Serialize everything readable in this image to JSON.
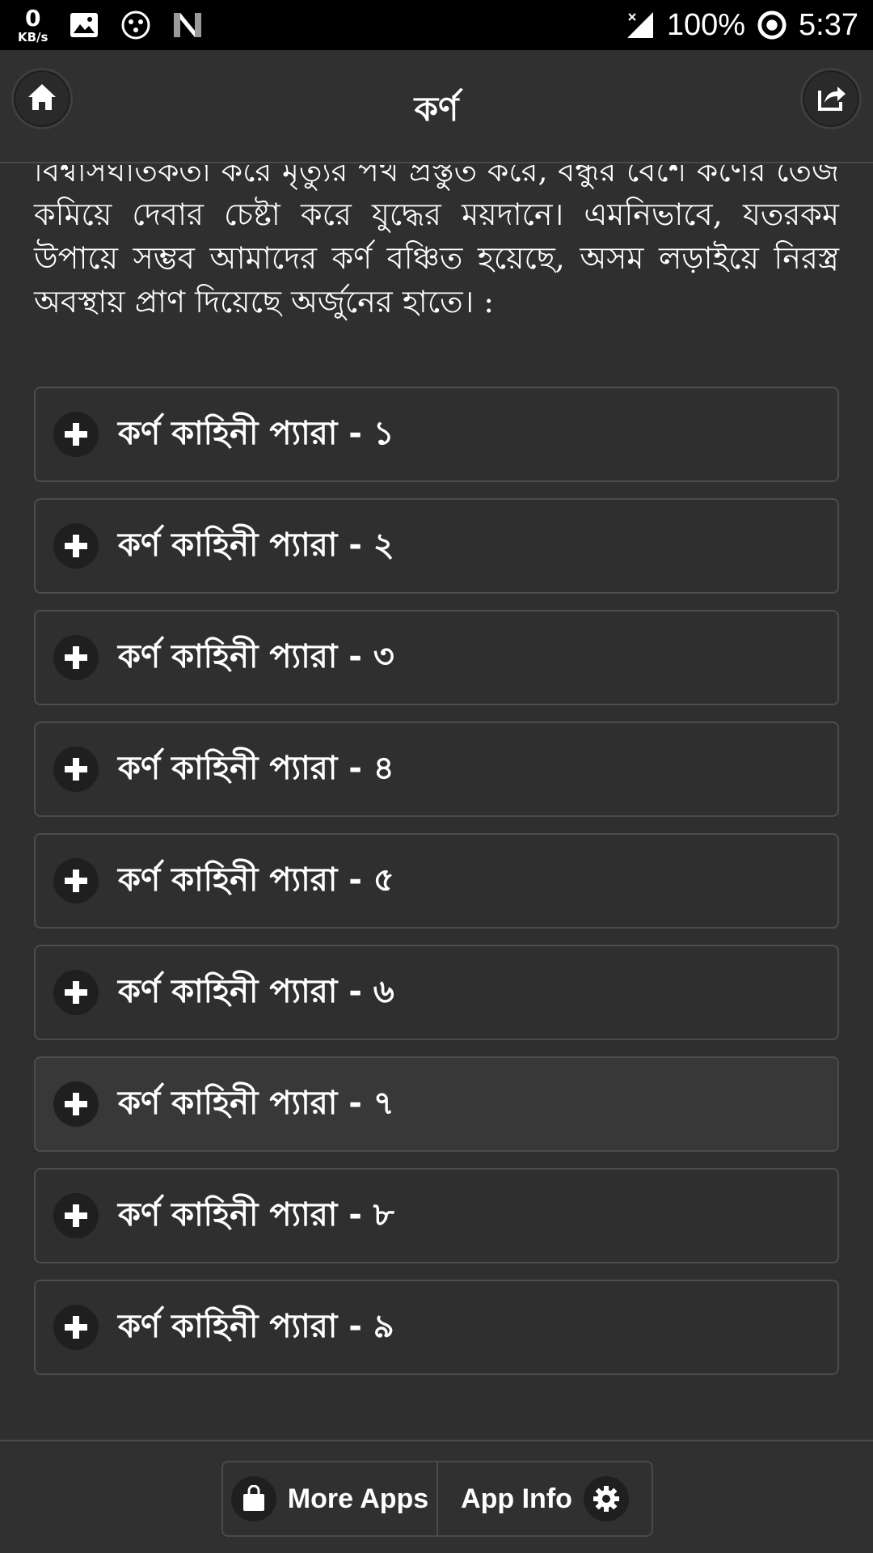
{
  "status_bar": {
    "speed_value": "0",
    "speed_unit": "KB/s",
    "battery": "100%",
    "time": "5:37",
    "icons": [
      "gallery-icon",
      "dots-app-icon",
      "n-logo-icon",
      "signal-icon",
      "battery-ring-icon"
    ]
  },
  "header": {
    "title": "কর্ণ",
    "home_icon": "home-icon",
    "share_icon": "share-icon"
  },
  "content": {
    "intro_text": "বিশ্বাসঘাতকতা করে মৃত্যুর পথ প্রস্তুত করে, বন্ধুর বেশে কর্ণের তেজ কমিয়ে দেবার চেষ্টা করে যুদ্ধের ময়দানে। এমনিভাবে, যতরকম উপায়ে সম্ভব আমাদের কর্ণ বঞ্চিত হয়েছে, অসম লড়াইয়ে নিরস্ত্র অবস্থায় প্রাণ দিয়েছে অর্জুনের হাতে। :",
    "items": [
      {
        "label": "কর্ণ কাহিনী প্যারা - ১"
      },
      {
        "label": "কর্ণ কাহিনী প্যারা - ২"
      },
      {
        "label": "কর্ণ কাহিনী প্যারা - ৩"
      },
      {
        "label": "কর্ণ কাহিনী প্যারা - ৪"
      },
      {
        "label": "কর্ণ কাহিনী প্যারা - ৫"
      },
      {
        "label": "কর্ণ কাহিনী প্যারা - ৬"
      },
      {
        "label": "কর্ণ কাহিনী প্যারা - ৭"
      },
      {
        "label": "কর্ণ কাহিনী প্যারা - ৮"
      },
      {
        "label": "কর্ণ কাহিনী প্যারা - ৯"
      }
    ]
  },
  "footer": {
    "more_apps_label": "More Apps",
    "app_info_label": "App Info"
  }
}
